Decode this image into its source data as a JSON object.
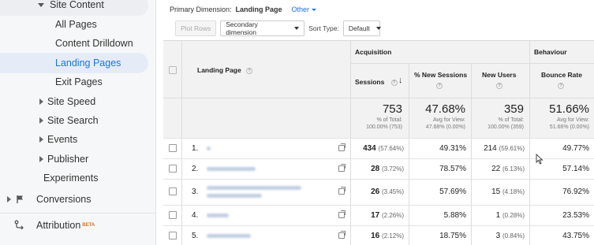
{
  "sidebar": {
    "site_content": "Site Content",
    "items": [
      {
        "label": "All Pages"
      },
      {
        "label": "Content Drilldown"
      },
      {
        "label": "Landing Pages"
      },
      {
        "label": "Exit Pages"
      }
    ],
    "groups": [
      {
        "label": "Site Speed"
      },
      {
        "label": "Site Search"
      },
      {
        "label": "Events"
      },
      {
        "label": "Publisher"
      }
    ],
    "experiments": "Experiments",
    "conversions": "Conversions",
    "attribution": "Attribution",
    "beta": "BETA"
  },
  "dimension_bar": {
    "label": "Primary Dimension:",
    "value": "Landing Page",
    "other": "Other"
  },
  "toolbar": {
    "plot_rows": "Plot Rows",
    "secondary_dimension": "Secondary dimension",
    "sort_type_label": "Sort Type:",
    "sort_type_value": "Default"
  },
  "table": {
    "group_acquisition": "Acquisition",
    "group_behaviour": "Behaviour",
    "col_landing_page": "Landing Page",
    "col_sessions": "Sessions",
    "col_new_sessions": "% New Sessions",
    "col_new_users": "New Users",
    "col_bounce_rate": "Bounce Rate",
    "totals": {
      "sessions": "753",
      "sessions_sub1": "% of Total:",
      "sessions_sub2": "100.00% (753)",
      "new_sessions": "47.68%",
      "new_sessions_sub1": "Avg for View:",
      "new_sessions_sub2": "47.68% (0.00%)",
      "new_users": "359",
      "new_users_sub1": "% of Total:",
      "new_users_sub2": "100.00% (359)",
      "bounce_rate": "51.66%",
      "bounce_rate_sub1": "Avg for View:",
      "bounce_rate_sub2": "51.66% (0.00%)"
    },
    "rows": [
      {
        "index": "1.",
        "page": "/",
        "sessions": "434",
        "sessions_pct": "(57.64%)",
        "new_sessions": "49.31%",
        "new_users": "214",
        "new_users_pct": "(59.61%)",
        "bounce_rate": "49.77%"
      },
      {
        "index": "2.",
        "page": "",
        "sessions": "28",
        "sessions_pct": "(3.72%)",
        "new_sessions": "78.57%",
        "new_users": "22",
        "new_users_pct": "(6.13%)",
        "bounce_rate": "57.14%"
      },
      {
        "index": "3.",
        "page": "",
        "sessions": "26",
        "sessions_pct": "(3.45%)",
        "new_sessions": "57.69%",
        "new_users": "15",
        "new_users_pct": "(4.18%)",
        "bounce_rate": "76.92%"
      },
      {
        "index": "4.",
        "page": "",
        "sessions": "17",
        "sessions_pct": "(2.26%)",
        "new_sessions": "5.88%",
        "new_users": "1",
        "new_users_pct": "(0.28%)",
        "bounce_rate": "23.53%"
      },
      {
        "index": "5.",
        "page": "",
        "sessions": "16",
        "sessions_pct": "(2.12%)",
        "new_sessions": "18.75%",
        "new_users": "3",
        "new_users_pct": "(0.84%)",
        "bounce_rate": "43.75%"
      }
    ]
  },
  "colors": {
    "accent": "#1a73e8",
    "active_nav_bg": "#e6ecf7",
    "header_bg": "#f2f2f2"
  }
}
